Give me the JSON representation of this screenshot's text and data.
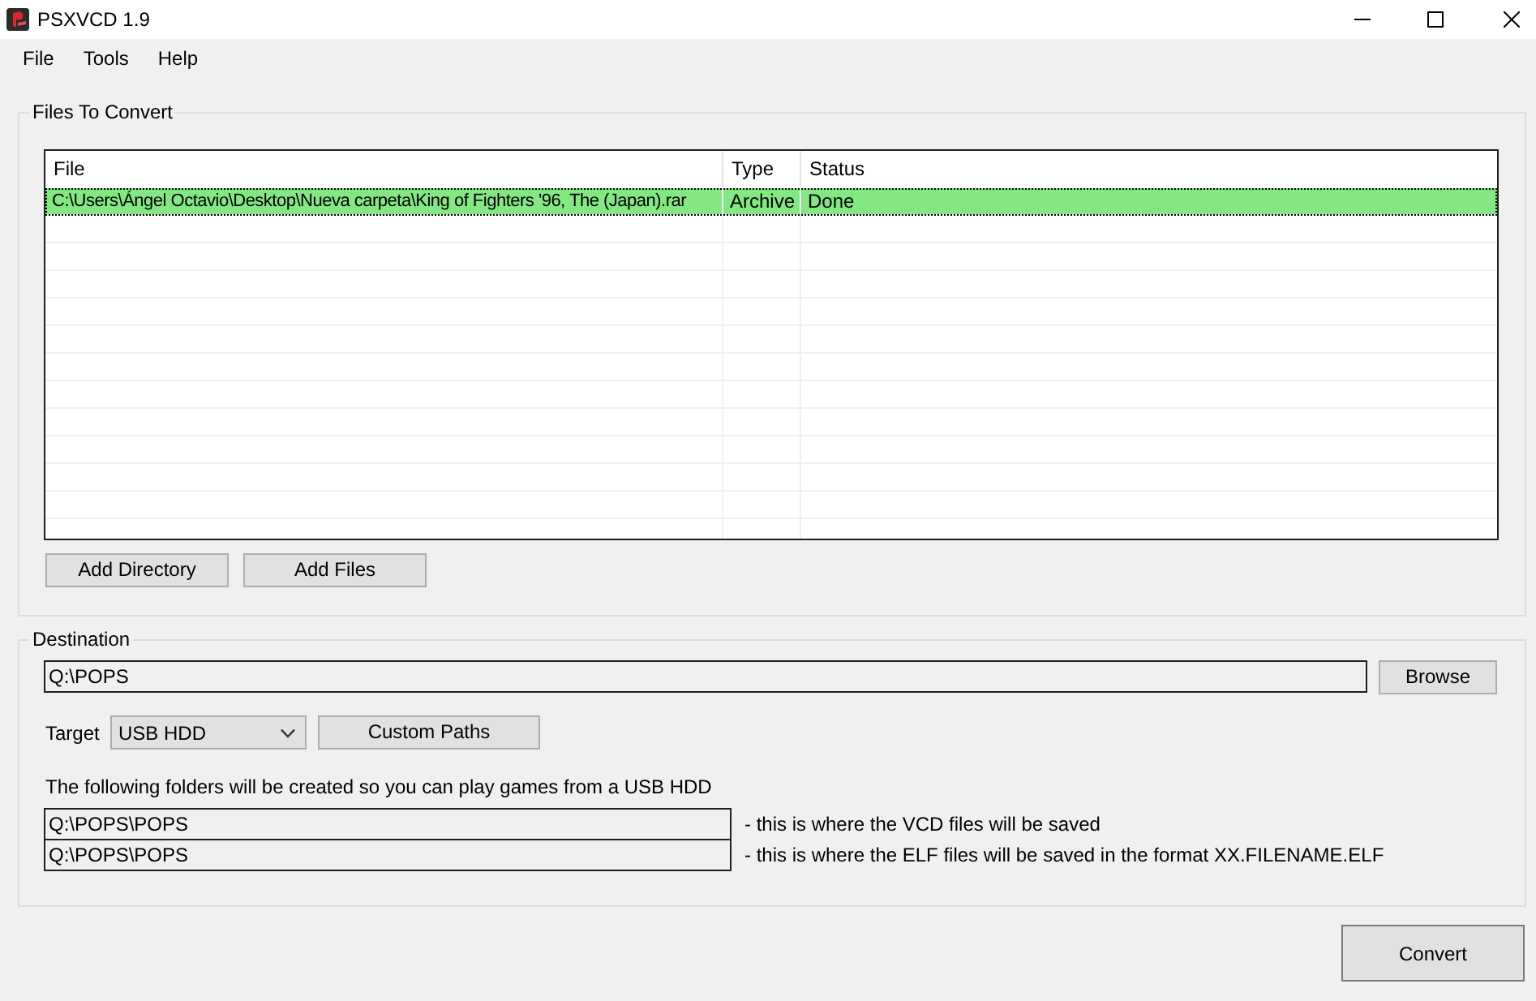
{
  "window": {
    "title": "PSXVCD 1.9"
  },
  "menu": [
    "File",
    "Tools",
    "Help"
  ],
  "files_group": {
    "title": "Files To Convert",
    "columns": [
      "File",
      "Type",
      "Status"
    ],
    "rows": [
      {
        "cells": [
          "C:\\Users\\Ángel Octavio\\Desktop\\Nueva carpeta\\King of Fighters '96, The (Japan).rar",
          "Archive",
          "Done"
        ],
        "color": "#84e784",
        "selected": true
      }
    ],
    "buttons": [
      "Add Directory",
      "Add Files"
    ]
  },
  "destination_group": {
    "title": "Destination",
    "path": "Q:\\POPS",
    "browse_button": "Browse",
    "target_label": "Target",
    "target": "USB HDD",
    "custom_paths_button": "Custom Paths",
    "info": "The following folders will be created so you can play games from a USB HDD",
    "folders": [
      {
        "path": "Q:\\POPS\\POPS",
        "note": "- this is where the VCD files will be saved"
      },
      {
        "path": "Q:\\POPS\\POPS",
        "note": "- this is where the ELF files will be saved in the format XX.FILENAME.ELF"
      }
    ]
  },
  "convert_button": "Convert"
}
